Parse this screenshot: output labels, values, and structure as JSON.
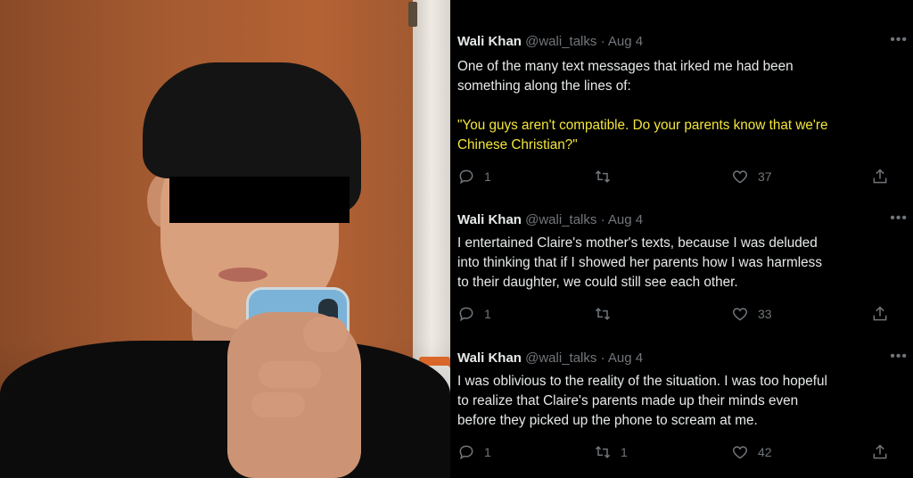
{
  "tweets": [
    {
      "name": "Wali Khan",
      "handle": "@wali_talks",
      "date": "Aug 4",
      "lines": [
        "One of the many text messages that irked me had been",
        "something along the lines of:"
      ],
      "quote_lines": [
        "\"You guys aren't compatible. Do your parents know that we're",
        "Chinese Christian?\""
      ],
      "replies": "1",
      "retweets": "",
      "likes": "37"
    },
    {
      "name": "Wali Khan",
      "handle": "@wali_talks",
      "date": "Aug 4",
      "lines": [
        "I entertained Claire's mother's texts, because I was deluded",
        "into thinking that if I showed her parents how I was harmless",
        "to their daughter, we could still see each other."
      ],
      "replies": "1",
      "retweets": "",
      "likes": "33"
    },
    {
      "name": "Wali Khan",
      "handle": "@wali_talks",
      "date": "Aug 4",
      "lines": [
        "I was oblivious to the reality of the situation. I was too hopeful",
        "to realize that Claire's parents made up their minds even",
        "before they picked up the phone to scream at me."
      ],
      "replies": "1",
      "retweets": "1",
      "likes": "42"
    }
  ],
  "icons": {
    "reply": "reply-icon",
    "retweet": "retweet-icon",
    "like": "heart-icon",
    "share": "share-icon",
    "more": "more-icon"
  },
  "colors": {
    "background": "#000000",
    "text": "#e7e9ea",
    "muted": "#71767b",
    "highlight": "#f3e53c"
  }
}
